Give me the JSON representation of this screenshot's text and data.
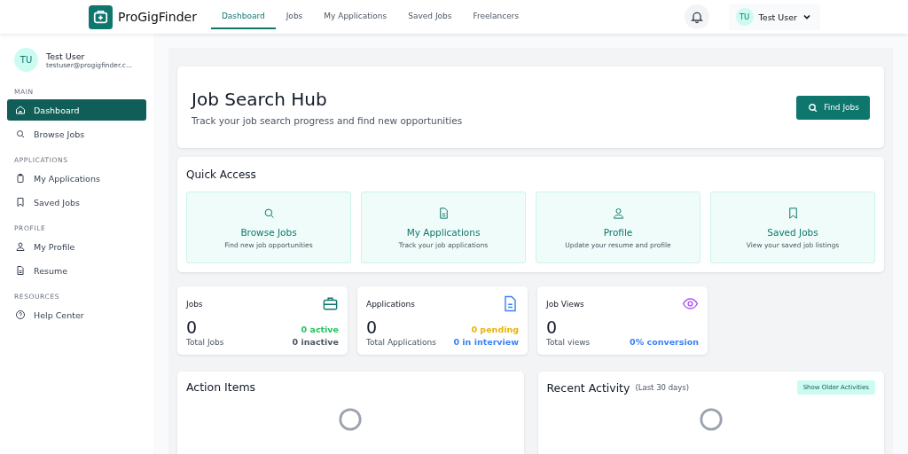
{
  "header": {
    "brand": "ProGigFinder",
    "nav": [
      {
        "label": "Dashboard",
        "selected": true
      },
      {
        "label": "Jobs",
        "selected": false
      },
      {
        "label": "My Applications",
        "selected": false
      },
      {
        "label": "Saved Jobs",
        "selected": false
      },
      {
        "label": "Freelancers",
        "selected": false
      }
    ],
    "user": {
      "initials": "TU",
      "name": "Test User"
    }
  },
  "sidebar": {
    "user": {
      "initials": "TU",
      "name": "Test User",
      "email": "testuser@progigfinder.c..."
    },
    "sections": [
      {
        "title": "MAIN",
        "items": [
          {
            "label": "Dashboard",
            "selected": true
          },
          {
            "label": "Browse Jobs",
            "selected": false
          }
        ]
      },
      {
        "title": "APPLICATIONS",
        "items": [
          {
            "label": "My Applications",
            "selected": false
          },
          {
            "label": "Saved Jobs",
            "selected": false
          }
        ]
      },
      {
        "title": "PROFILE",
        "items": [
          {
            "label": "My Profile",
            "selected": false
          },
          {
            "label": "Resume",
            "selected": false
          }
        ]
      },
      {
        "title": "RESOURCES",
        "items": [
          {
            "label": "Help Center",
            "selected": false
          }
        ]
      }
    ]
  },
  "hero": {
    "title": "Job Search Hub",
    "subtitle": "Track your job search progress and find new opportunities",
    "button": "Find Jobs"
  },
  "quick_access": {
    "title": "Quick Access",
    "items": [
      {
        "title": "Browse Jobs",
        "description": "Find new job opportunities"
      },
      {
        "title": "My Applications",
        "description": "Track your job applications"
      },
      {
        "title": "Profile",
        "description": "Update your resume and profile"
      },
      {
        "title": "Saved Jobs",
        "description": "View your saved job listings"
      }
    ]
  },
  "stats": [
    {
      "title": "Jobs",
      "value": "0",
      "caption": "Total Jobs",
      "lines": [
        {
          "text": "0 active",
          "color": "#22c55e"
        },
        {
          "text": "0 inactive",
          "color": "#4b5563"
        }
      ]
    },
    {
      "title": "Applications",
      "value": "0",
      "caption": "Total Applications",
      "lines": [
        {
          "text": "0 pending",
          "color": "#eab308"
        },
        {
          "text": "0 in interview",
          "color": "#3b82f6"
        }
      ]
    },
    {
      "title": "Job Views",
      "value": "0",
      "caption": "Total views",
      "lines": [
        {
          "text": "0% conversion",
          "color": "#3b82f6"
        }
      ]
    }
  ],
  "action_items": {
    "title": "Action Items"
  },
  "recent_activity": {
    "title": "Recent Activity",
    "note": "(Last 30 days)",
    "button": "Show Older Activities"
  }
}
